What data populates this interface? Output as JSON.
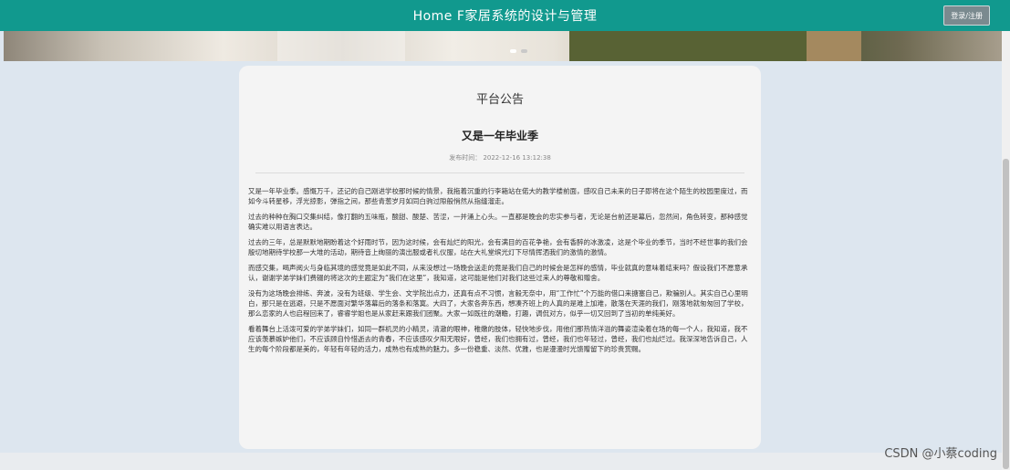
{
  "header": {
    "title": "Home F家居系统的设计与管理",
    "login_label": "登录/注册"
  },
  "notice": {
    "section_title": "平台公告",
    "title": "又是一年毕业季",
    "publish_label": "发布时间：",
    "publish_time": "2022-12-16 13:12:38",
    "paragraphs": [
      "又是一年毕业季。感慨万千，还记的自己刚进学校那时候的情景，我拖着沉重的行李箱站在偌大的教学楼前面，感叹自己未来的日子即将在这个陌生的校园里度过，而如今斗转星移，浮光掠影，弹指之间，那些青葱岁月如同白驹过隙般悄然从指缝溜走。",
      "过去的种种在胸口交集纠结，像打翻的五味瓶，酸甜、酸楚、苦涩，一并涌上心头。一直都是晚会的忠实参与者，无论是台前还是幕后，忽然间，角色转变，那种感觉确实难以用语言表达。",
      "过去的三年，总是默默地期盼着这个好雨时节，因为这时候，会有灿烂的阳光，会有满目的百花争艳，会有香醉的冰激凌，这是个毕业的季节，当时不经世事的我们会殷切地期待学校那一大堆的活动，期待音上绚丽的演出服或者礼仪服，站在大礼堂缤光灯下尽情挥洒我们的激情的激情。",
      "而感交集，喝声阅火与身临其境的感觉竟是如此不同，从来没想过一场晚会送走的竟是我们自己的时候会是怎样的感情，毕业就真的意味着结束吗？假设我们不愿意承认，谢谢学弟学妹们费辍的将这次的主题定为“我们在这里”，我知道，这可能是他们对我们这些过来人的尊敬和赠舍。",
      "没有为这场晚会排练、奔波，没有为班级、学生会、文学院出点力，还真有点不习惯，言毅无奈中，用“工作忙”个万能的借口来搪塞自己，欺骗别人。其实自己心里明白，那只是在逃避，只是不愿面对繁华落幕后的落条和落寞。大四了，大家各奔东西，想凑齐班上的人真的是难上加难，散落在天涯的我们，刚落地就匆匆回了学校，那么恋家的人也启程回来了，睿睿学姐也是从家赶来跟我们团聚。大家一如既往的潮瞻，打趣，调侃对方，似乎一切又回到了当初的单纯美好。",
      "看着舞台上活泼可爱的学弟学妹们，如同一群机灵的小精灵，清澈的眼神，稚嫩的肢体，轻快地步伐，用他们那热情洋溢的舞姿渲染着在场的每一个人，我知道，我不应该羡慕嫉妒他们，不应该顾自怜惜逝去的青春，不应该感叹夕阳无限好，曾经，我们也拥有过，曾经，我们也年轻过，曾经，我们也灿烂过。我深深地告诉自己，人生的每个阶段都是美的，年轻有年轻的活力，成熟也有成熟的魅力。多一份稳重、淡然、优雅，也是漫漫时光馈赠留下的珍贵赏赐。"
    ]
  },
  "watermark": "CSDN @小蔡coding"
}
